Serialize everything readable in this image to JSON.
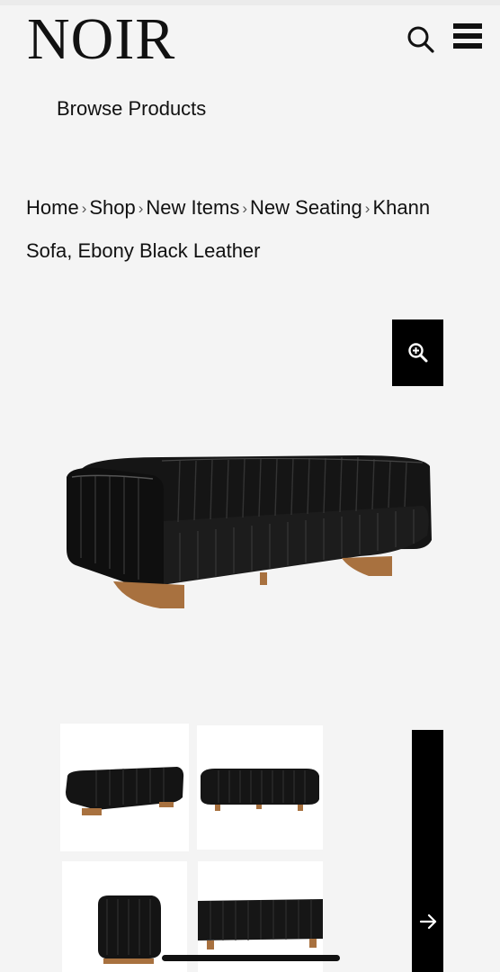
{
  "header": {
    "brand": "NOIR",
    "search_icon": "search-icon",
    "menu_icon": "hamburger-menu-icon"
  },
  "nav": {
    "browse_label": "Browse Products"
  },
  "breadcrumb": {
    "items": [
      "Home",
      "Shop",
      "New Items",
      "New Seating",
      "Khann Sofa, Ebony Black Leather"
    ],
    "separator": "›"
  },
  "product": {
    "zoom_icon": "zoom-in-icon",
    "main_image": "black-leather-sofa",
    "thumbnails": [
      "sofa-angle-view",
      "sofa-front-view",
      "sofa-side-view",
      "sofa-back-view"
    ],
    "next_icon": "arrow-right-icon"
  },
  "colors": {
    "background": "#f4f4f4",
    "accent": "#000000",
    "wood": "#a8713f"
  }
}
